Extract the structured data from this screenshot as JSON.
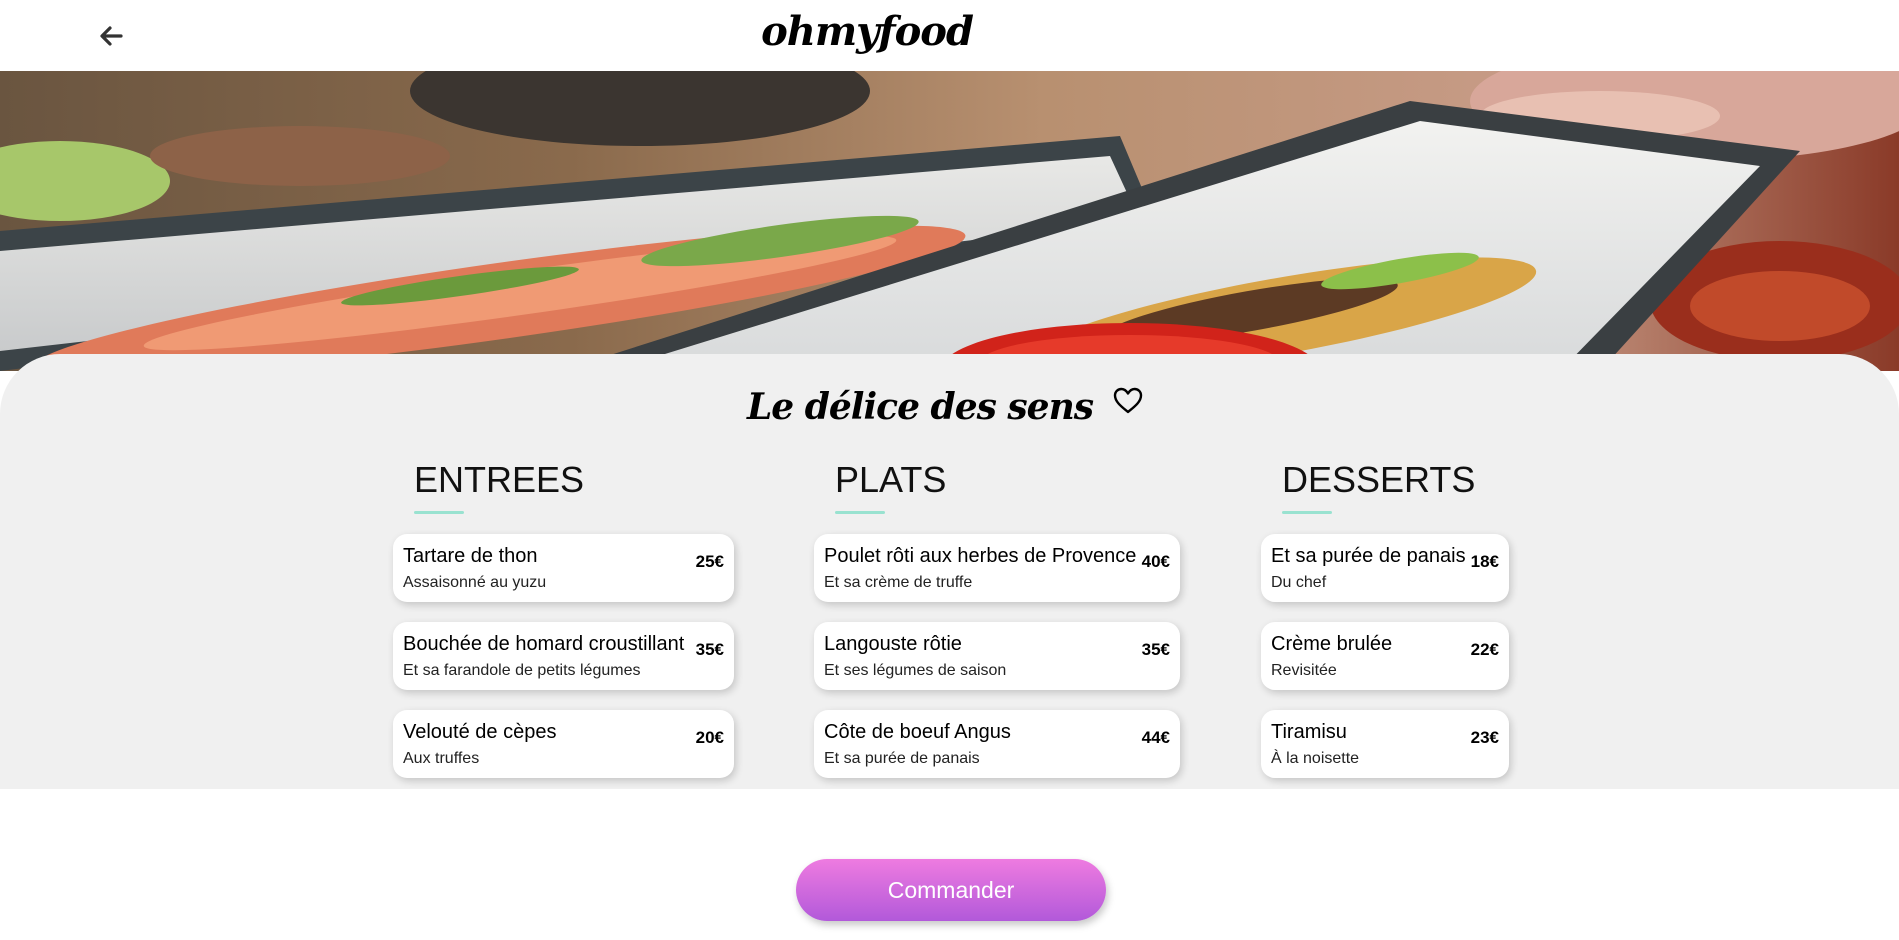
{
  "header": {
    "logo": "ohmyfood",
    "back_icon": "arrow-left-icon"
  },
  "hero": {
    "image": "food-dish-photo"
  },
  "restaurant": {
    "name": "Le délice des sens",
    "favorite_icon": "heart-outline-icon"
  },
  "menu": {
    "columns": [
      {
        "heading": "ENTREES",
        "dishes": [
          {
            "name": "Tartare de thon",
            "description": "Assaisonné au yuzu",
            "price": "25€"
          },
          {
            "name": "Bouchée de homard croustillant",
            "description": "Et sa farandole de petits légumes",
            "price": "35€"
          },
          {
            "name": "Velouté de cèpes",
            "description": "Aux truffes",
            "price": "20€"
          }
        ]
      },
      {
        "heading": "PLATS",
        "dishes": [
          {
            "name": "Poulet rôti aux herbes de Provence",
            "description": "Et sa crème de truffe",
            "price": "40€"
          },
          {
            "name": "Langouste rôtie",
            "description": "Et ses légumes de saison",
            "price": "35€"
          },
          {
            "name": "Côte de boeuf Angus",
            "description": "Et sa purée de panais",
            "price": "44€"
          }
        ]
      },
      {
        "heading": "DESSERTS",
        "dishes": [
          {
            "name": "Et sa purée de panais",
            "description": "Du chef",
            "price": "18€"
          },
          {
            "name": "Crème brulée",
            "description": "Revisitée",
            "price": "22€"
          },
          {
            "name": "Tiramisu",
            "description": "À la noisette",
            "price": "23€"
          }
        ]
      }
    ]
  },
  "order_button": {
    "label": "Commander"
  },
  "colors": {
    "accent_underline": "#99e2d0",
    "button_gradient_top": "#ee7be0",
    "button_gradient_bottom": "#b259da",
    "panel_background": "#f0f0f0"
  }
}
